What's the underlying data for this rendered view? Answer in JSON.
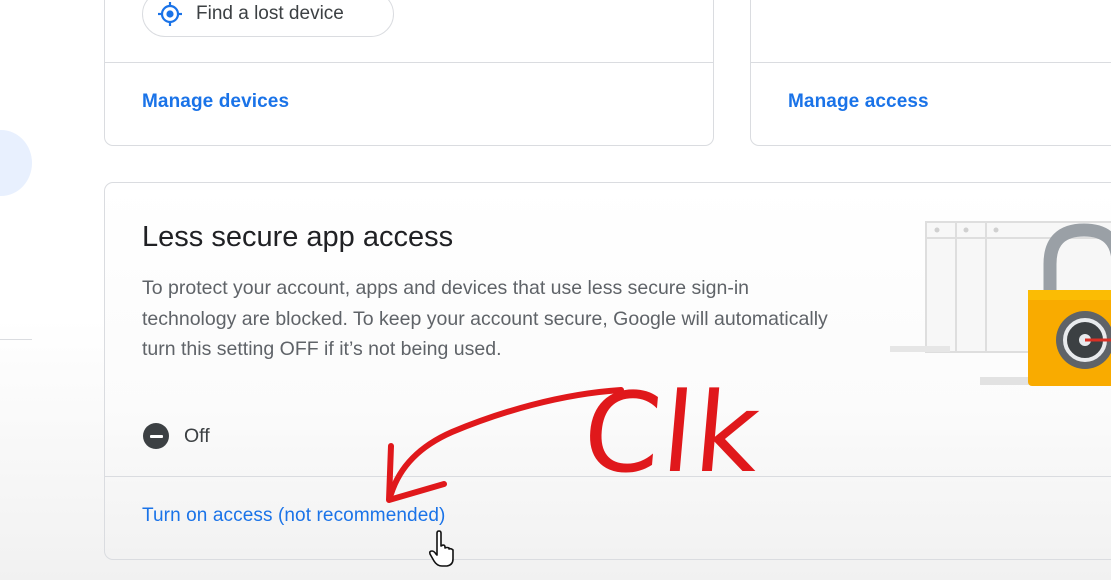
{
  "devices_card": {
    "find_device_label": "Find a lost device",
    "manage_link": "Manage devices"
  },
  "access_card": {
    "manage_link": "Manage access"
  },
  "less_secure_card": {
    "title": "Less secure app access",
    "description": "To protect your account, apps and devices that use less secure sign-in technology are blocked. To keep your account secure, Google will automatically turn this setting OFF if it’s not being used.",
    "status": "Off",
    "action_link": "Turn on access (not recommended)"
  },
  "annotation": {
    "text": "Clk",
    "color": "#e0181b"
  },
  "colors": {
    "link_blue": "#1a73e8",
    "lock_yellow": "#f9ab00",
    "border": "#dadce0"
  },
  "icons": {
    "find_device": "location-target-icon",
    "status": "minus-circle-icon",
    "illustration": "padlock-browser-illustration",
    "cursor": "hand-pointer-icon"
  }
}
